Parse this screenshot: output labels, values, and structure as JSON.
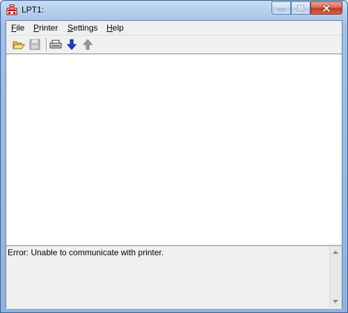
{
  "window": {
    "title": "LPT1:",
    "icons": {
      "app": "printer-app-icon",
      "minimize": "minimize-icon",
      "maximize": "maximize-icon",
      "close": "close-icon"
    }
  },
  "menubar": {
    "items": [
      {
        "label": "File",
        "accel": "F"
      },
      {
        "label": "Printer",
        "accel": "P"
      },
      {
        "label": "Settings",
        "accel": "S"
      },
      {
        "label": "Help",
        "accel": "H"
      }
    ]
  },
  "toolbar": {
    "icons": [
      "open-folder-icon",
      "save-icon",
      "printer-icon",
      "download-arrow-icon",
      "upload-arrow-icon"
    ],
    "colors": {
      "accent_blue": "#1b3fd6",
      "disabled_gray": "#9a9a9a"
    }
  },
  "status": {
    "message": "Error:  Unable to communicate with printer."
  }
}
